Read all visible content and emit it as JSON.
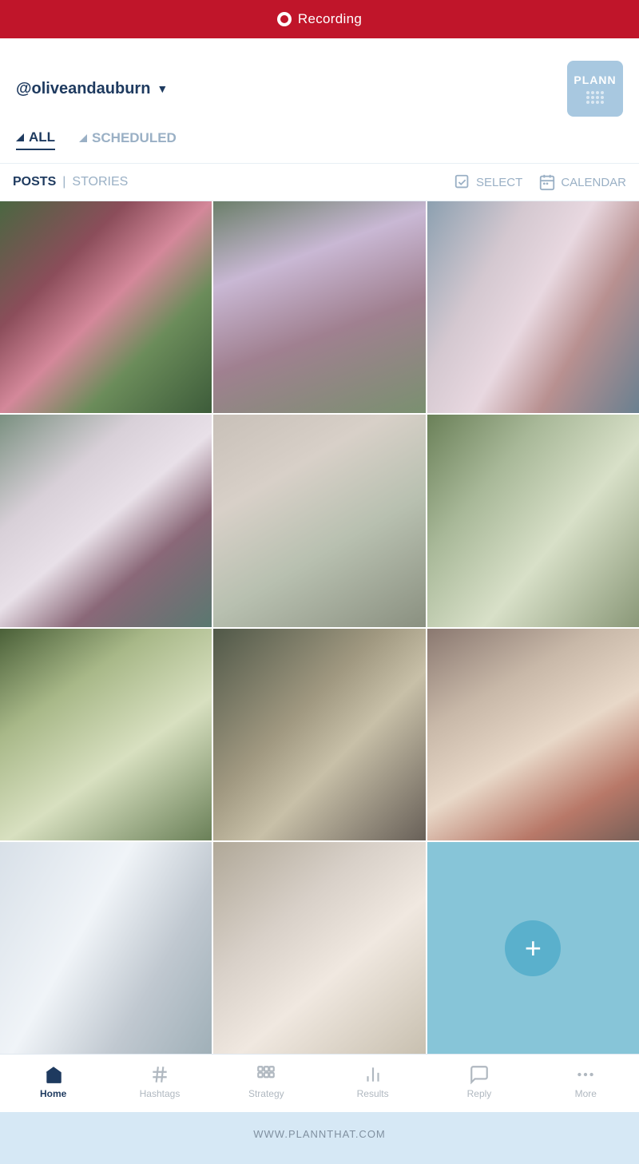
{
  "recording": {
    "label": "Recording"
  },
  "header": {
    "account": "@oliveandauburn",
    "logo_text": "PLANN"
  },
  "tabs": [
    {
      "id": "all",
      "label": "ALL",
      "active": true
    },
    {
      "id": "scheduled",
      "label": "SCHEDULED",
      "active": false
    }
  ],
  "content_bar": {
    "type_posts": "POSTS",
    "separator": "|",
    "type_stories": "STORIES",
    "action_select": "SELECT",
    "action_calendar": "CALENDAR"
  },
  "grid": {
    "add_button": "+"
  },
  "bottom_nav": [
    {
      "id": "home",
      "label": "Home",
      "active": true
    },
    {
      "id": "hashtags",
      "label": "Hashtags",
      "active": false
    },
    {
      "id": "strategy",
      "label": "Strategy",
      "active": false
    },
    {
      "id": "results",
      "label": "Results",
      "active": false
    },
    {
      "id": "reply",
      "label": "Reply",
      "active": false
    },
    {
      "id": "more",
      "label": "More",
      "active": false
    }
  ],
  "footer": {
    "url": "WWW.PLANNTHAT.COM"
  }
}
